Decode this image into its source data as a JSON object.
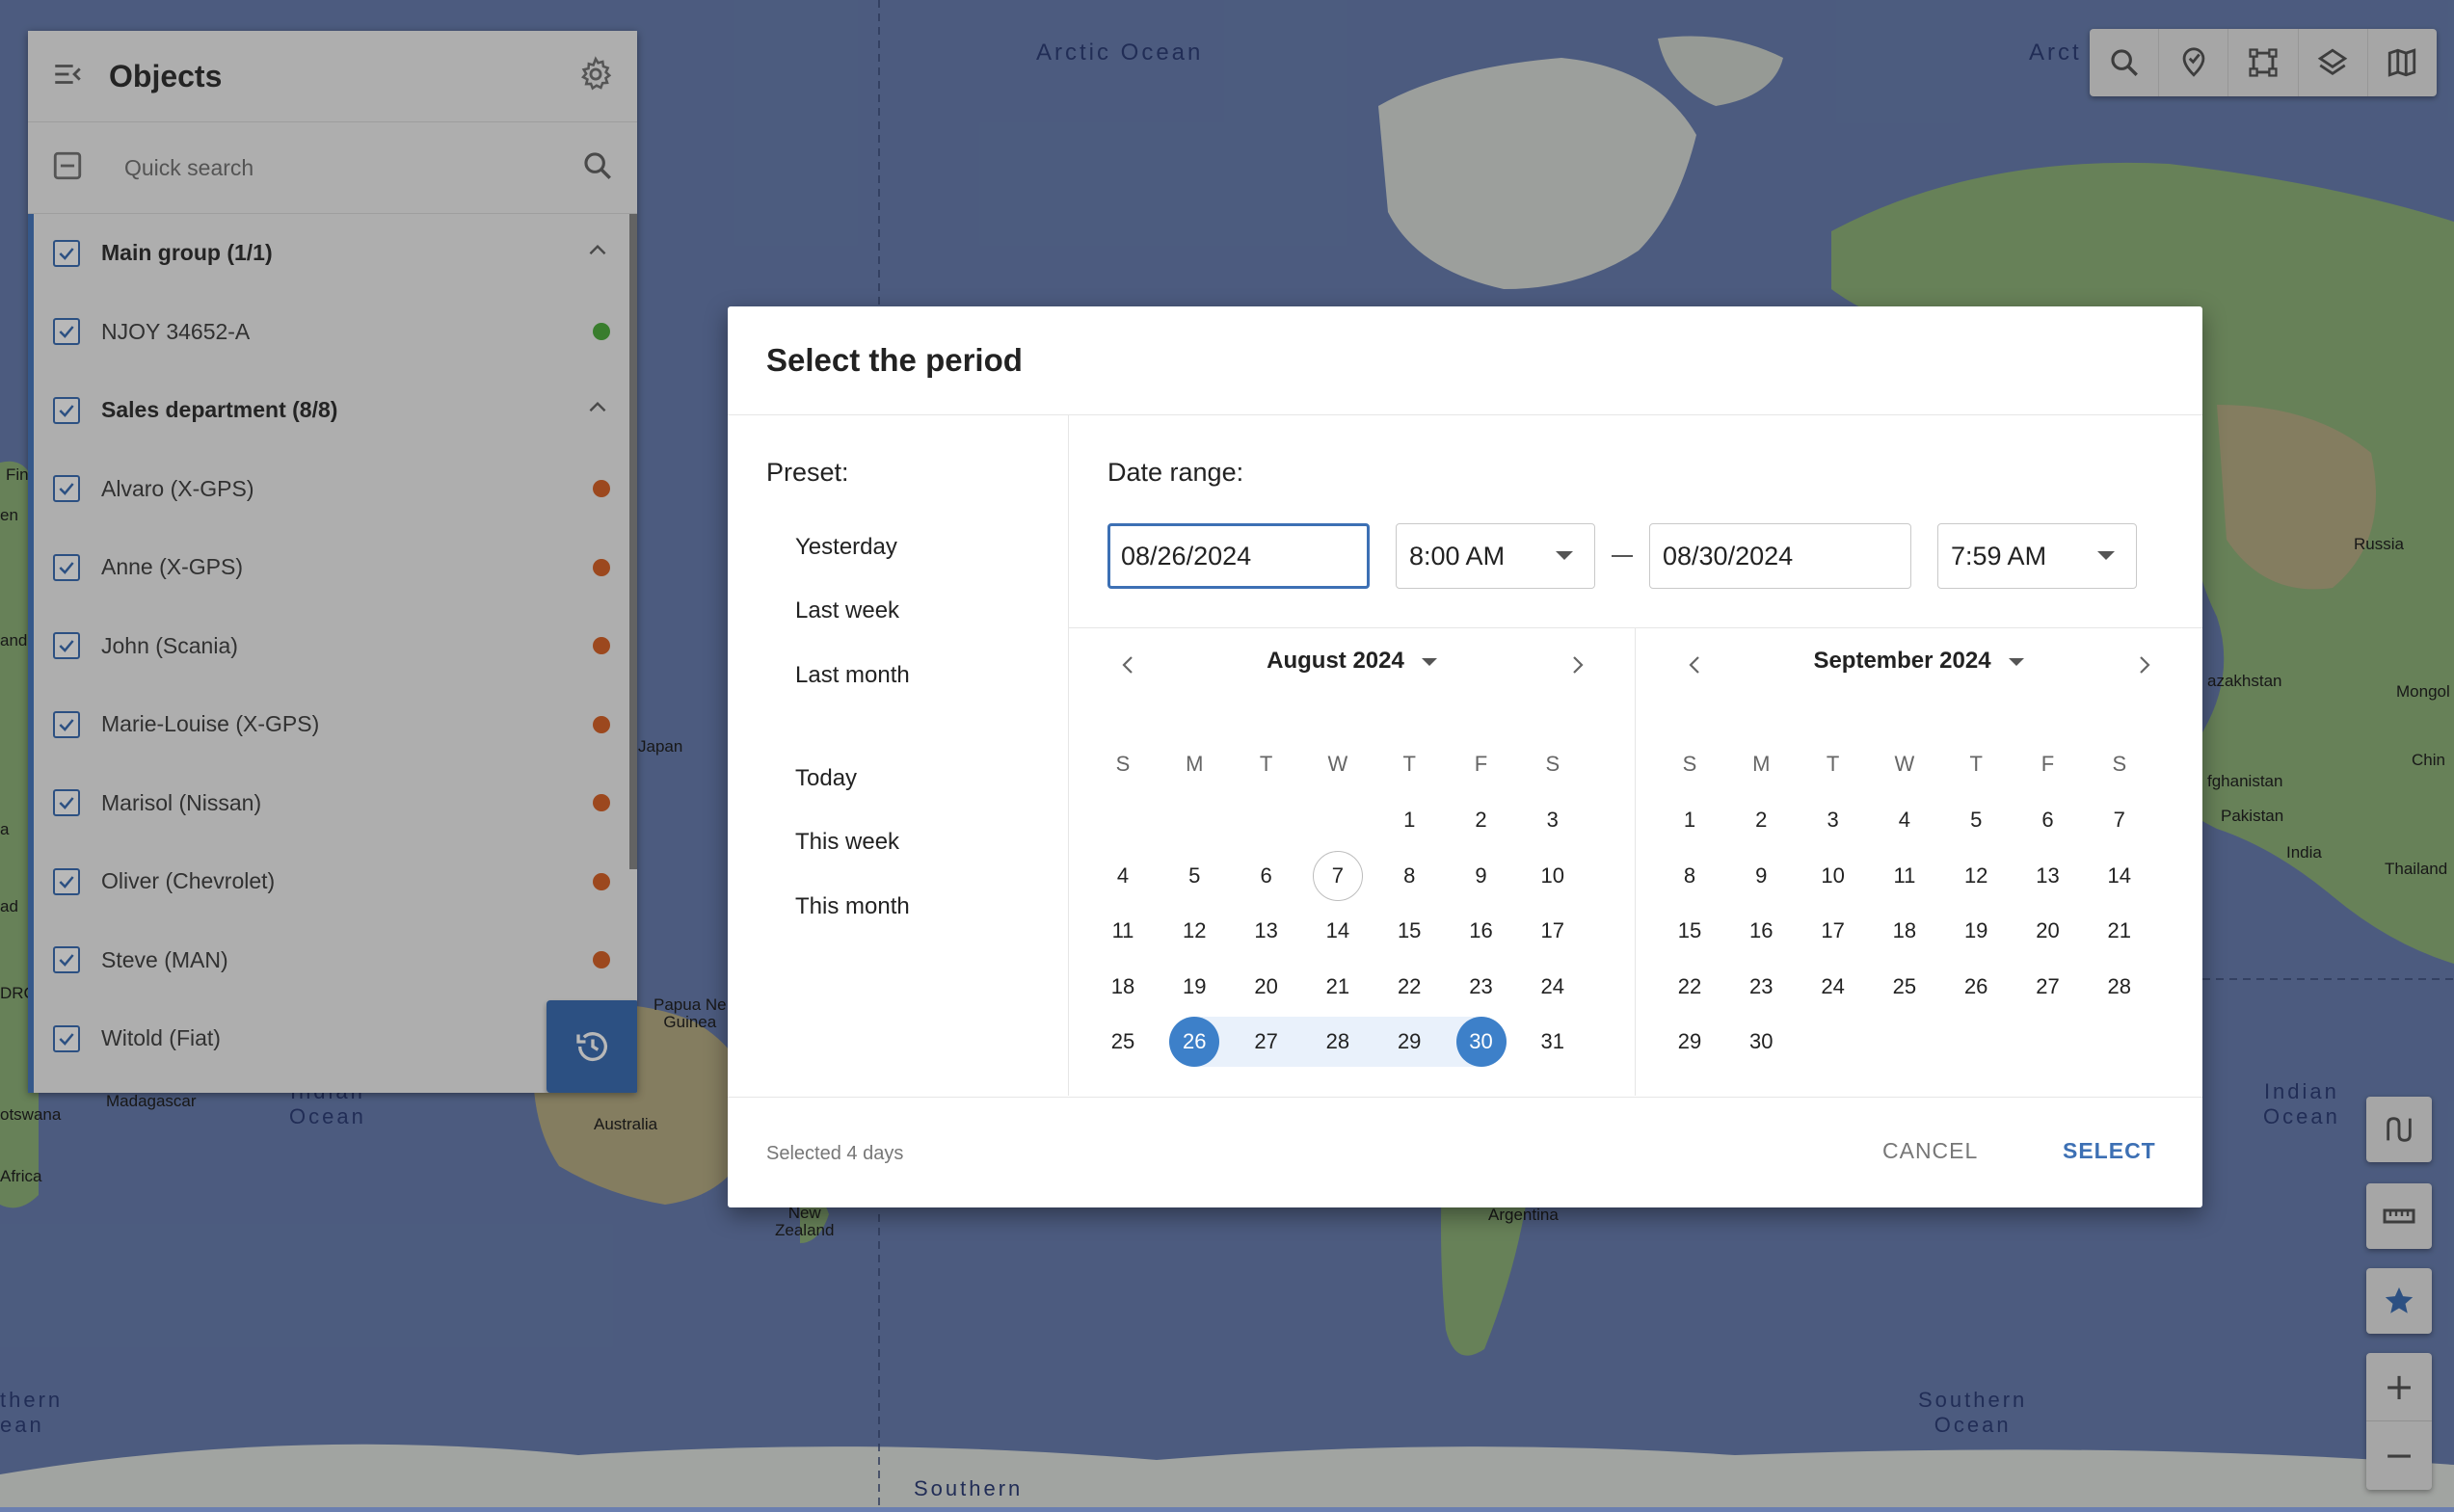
{
  "colors": {
    "accent": "#3d70b4",
    "selected_day": "#3d80c9",
    "range_band": "#e9f1fb",
    "status_online": "#4fae3f",
    "status_offline": "#d8642a",
    "ocean": "#6a7fb0"
  },
  "map": {
    "labels": {
      "arctic_ocean": "Arctic Ocean",
      "arctic_right": "Arct",
      "russia": "Russia",
      "kazakhstan": "azakhstan",
      "mongolia": "Mongol",
      "afghanistan": "fghanistan",
      "pakistan": "Pakistan",
      "india": "India",
      "thailand": "Thailand",
      "china": "Chin",
      "japan": "Japan",
      "papua": "Papua Ne\nGuinea",
      "australia": "Australia",
      "madagascar": "Madagascar",
      "botswana": "otswana",
      "africa": "Africa",
      "new_zealand": "New\nZealand",
      "argentina": "Argentina",
      "indian_ocean_left": "Indian\nOcean",
      "indian_ocean_right": "Indian\nOcean",
      "southern_ocean_right": "Southern\nOcean",
      "southern_ocean_bottom": "Southern",
      "southern_ocean_left": "thern\nean",
      "left_fin": "Fin",
      "left_en": "en",
      "left_and": "and",
      "left_a": "a",
      "left_ad": "ad",
      "left_drc": "DRC"
    }
  },
  "toolbar": {
    "icons": [
      "search-icon",
      "geofence-icon",
      "polygon-icon",
      "layers-icon",
      "map-icon"
    ]
  },
  "side_tools": {
    "icons": [
      "route-icon",
      "ruler-icon",
      "star-icon"
    ],
    "zoom_in": "+",
    "zoom_out": "−"
  },
  "objects_panel": {
    "title": "Objects",
    "search_placeholder": "Quick search",
    "rows": [
      {
        "label": "Main group (1/1)",
        "type": "group"
      },
      {
        "label": "NJOY 34652-A",
        "type": "item",
        "status": "green"
      },
      {
        "label": "Sales department (8/8)",
        "type": "group"
      },
      {
        "label": "Alvaro (X-GPS)",
        "type": "item",
        "status": "orange"
      },
      {
        "label": "Anne (X-GPS)",
        "type": "item",
        "status": "orange"
      },
      {
        "label": "John (Scania)",
        "type": "item",
        "status": "orange"
      },
      {
        "label": "Marie-Louise (X-GPS)",
        "type": "item",
        "status": "orange"
      },
      {
        "label": "Marisol (Nissan)",
        "type": "item",
        "status": "orange"
      },
      {
        "label": "Oliver (Chevrolet)",
        "type": "item",
        "status": "orange"
      },
      {
        "label": "Steve (MAN)",
        "type": "item",
        "status": "orange"
      },
      {
        "label": "Witold (Fiat)",
        "type": "item",
        "status": "orange"
      }
    ]
  },
  "dialog": {
    "title": "Select the period",
    "preset_heading": "Preset:",
    "presets": [
      "Yesterday",
      "Last week",
      "Last month",
      "Today",
      "This week",
      "This month"
    ],
    "range_heading": "Date range:",
    "start_date": "08/26/2024",
    "start_time": "8:00 AM",
    "end_date": "08/30/2024",
    "end_time": "7:59 AM",
    "weekdays": [
      "S",
      "M",
      "T",
      "W",
      "T",
      "F",
      "S"
    ],
    "calendars": [
      {
        "title": "August 2024",
        "first_weekday": 4,
        "days": 31,
        "today": 7,
        "range_start": 26,
        "range_end": 30
      },
      {
        "title": "September 2024",
        "first_weekday": 0,
        "days": 30
      }
    ],
    "footer_info": "Selected 4 days",
    "cancel_label": "CANCEL",
    "select_label": "SELECT"
  }
}
